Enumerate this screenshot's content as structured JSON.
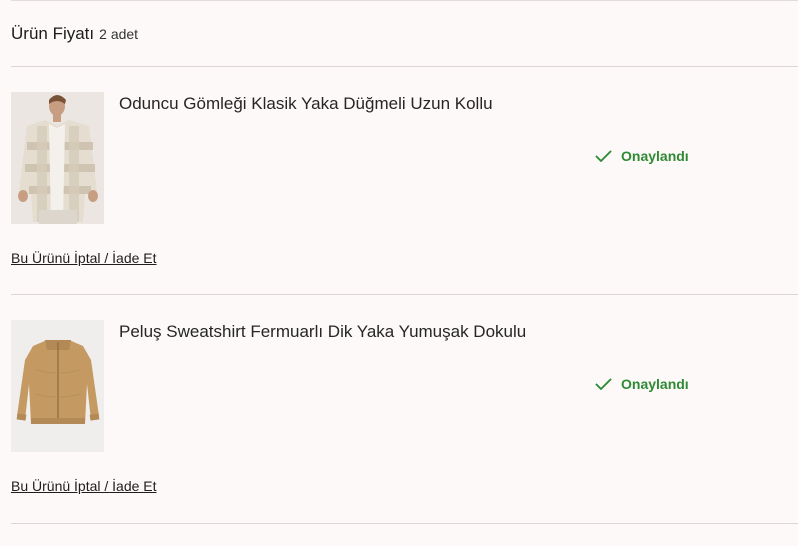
{
  "header": {
    "title": "Ürün Fiyatı",
    "count": "2 adet"
  },
  "items": [
    {
      "name": "Oduncu Gömleği Klasik Yaka Düğmeli Uzun Kollu",
      "status": "Onaylandı",
      "action": "Bu Ürünü İptal / İade Et",
      "image": "beige-checked-shirt-image"
    },
    {
      "name": "Peluş Sweatshirt Fermuarlı Dik Yaka Yumuşak Dokulu",
      "status": "Onaylandı",
      "action": "Bu Ürünü İptal / İade Et",
      "image": "camel-zip-sweatshirt-image"
    }
  ],
  "colors": {
    "status": "#2e8a34",
    "background": "#fdf9f8",
    "divider": "#ddd6d5"
  }
}
